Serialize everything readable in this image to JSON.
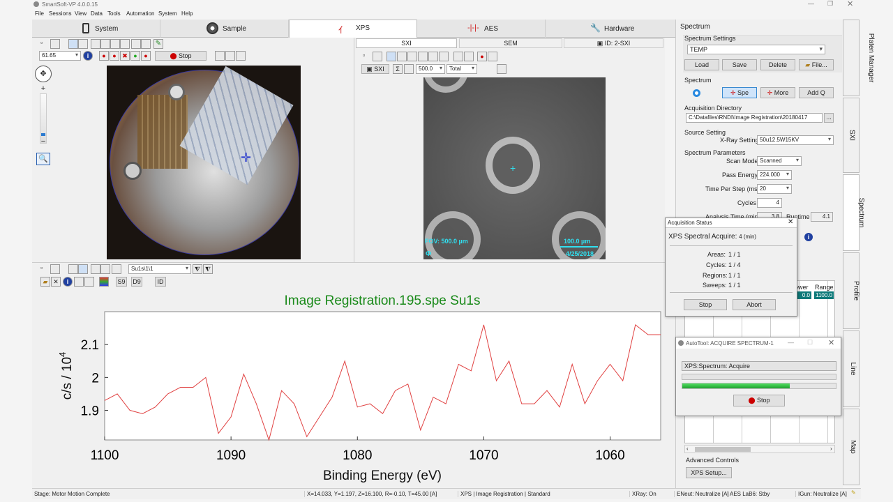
{
  "app": {
    "title": "SmartSoft-VP 4.0.0.15"
  },
  "menu": [
    "File",
    "Sessions",
    "View",
    "Data",
    "Tools",
    "Automation",
    "System",
    "Help"
  ],
  "tabs": {
    "system": "System",
    "sample": "Sample",
    "xps": "XPS",
    "aes": "AES",
    "hardware": "Hardware"
  },
  "camera": {
    "zoom_value": "61.65",
    "stop": "Stop"
  },
  "sxi": {
    "tab_sxi": "SXI",
    "tab_sem": "SEM",
    "tab_id": "ID: 2-SXI",
    "sxi_btn": "SXI",
    "size_value": "500.0",
    "mode_value": "Total",
    "fov": "FOV: 500.0 µm",
    "scale": "100.0 µm",
    "date": "4/25/2018",
    "icon_char": "Φ"
  },
  "plot_toolbar": {
    "region_value": "Su1s\\1\\1",
    "s9": "S9",
    "d9": "D9",
    "id": "ID"
  },
  "chart_data": {
    "type": "line",
    "title": "Image Registration.195.spe Su1s",
    "xlabel": "Binding Energy (eV)",
    "ylabel": "c/s / 10",
    "ylabel_exp": "4",
    "x_ticks": [
      1100,
      1090,
      1080,
      1070,
      1060
    ],
    "y_ticks": [
      1.9,
      2,
      2.1
    ],
    "x_range": [
      1100,
      1056
    ],
    "y_range": [
      1.81,
      2.2
    ],
    "x_reversed": true,
    "grid": false,
    "series": [
      {
        "color": "#e04040",
        "x": [
          1100,
          1099,
          1098,
          1097,
          1096,
          1095,
          1094,
          1093,
          1092,
          1091,
          1090,
          1089,
          1088,
          1087,
          1086,
          1085,
          1084,
          1083,
          1082,
          1081,
          1080,
          1079,
          1078,
          1077,
          1076,
          1075,
          1074,
          1073,
          1072,
          1071,
          1070,
          1069,
          1068,
          1067,
          1066,
          1065,
          1064,
          1063,
          1062,
          1061,
          1060,
          1059,
          1058,
          1057,
          1056
        ],
        "y": [
          1.93,
          1.95,
          1.9,
          1.89,
          1.91,
          1.95,
          1.97,
          1.97,
          2.0,
          1.83,
          1.88,
          2.01,
          1.92,
          1.81,
          1.96,
          1.92,
          1.82,
          1.88,
          1.94,
          2.05,
          1.91,
          1.92,
          1.89,
          1.96,
          1.98,
          1.84,
          1.94,
          1.92,
          2.04,
          2.02,
          2.16,
          1.99,
          2.05,
          1.92,
          1.92,
          1.96,
          1.91,
          2.04,
          1.92,
          1.99,
          2.04,
          1.99,
          2.16,
          2.13,
          2.13
        ]
      }
    ]
  },
  "side": {
    "header": "Spectrum",
    "settings_label": "Spectrum Settings",
    "settings_value": "TEMP",
    "load": "Load",
    "save": "Save",
    "delete": "Delete",
    "file": "File...",
    "spectrum_label": "Spectrum",
    "spe": "Spe",
    "more": "More",
    "add_q": "Add Q",
    "dir_label": "Acquisition Directory",
    "dir_value": "C:\\Datafiles\\RNDI\\Image Registration\\20180417",
    "dir_btn": "...",
    "source_label": "Source Setting",
    "xray_label": "X-Ray Setting",
    "xray_value": "50u12.5W15KV",
    "params_label": "Spectrum Parameters",
    "scan_label": "Scan Mode",
    "scan_value": "Scanned",
    "pass_label": "Pass Energy",
    "pass_value": "224.000",
    "tps_label": "Time Per Step (ms)",
    "tps_value": "20",
    "cycles_label": "Cycles",
    "cycles_value": "4",
    "analysis_label": "Analysis Time (min)",
    "analysis_value": "3.8",
    "runtime_label": "Runtime",
    "runtime_value": "4.1",
    "col_power": "ower",
    "col_range": "Range",
    "cell_power": "0.0",
    "cell_range": "1100.0",
    "advanced_label": "Advanced Controls",
    "xps_setup": "XPS Setup..."
  },
  "vtabs": [
    "Platen Manager",
    "SXI",
    "Spectrum",
    "Profile",
    "Line",
    "Map"
  ],
  "acq": {
    "title": "Acquisition Status",
    "heading": "XPS Spectral Acquire:",
    "minutes": "4 (min)",
    "areas_label": "Areas:",
    "areas_value": "1 / 1",
    "cycles_label": "Cycles:",
    "cycles_value": "1 / 4",
    "regions_label": "Regions:",
    "regions_value": "1 / 1",
    "sweeps_label": "Sweeps:",
    "sweeps_value": "1 / 1",
    "stop": "Stop",
    "abort": "Abort"
  },
  "autotool": {
    "title": "AutoTool: ACQUIRE SPECTRUM-1",
    "status": "XPS:Spectrum: Acquire",
    "progress": 0.7,
    "stop": "Stop"
  },
  "statusbar": {
    "stage": "Stage: Motor Motion Complete",
    "coords": "X=14.033, Y=1.197, Z=16.100, R=-0.10, T=45.00 [A]",
    "mode": "XPS | Image Registration | Standard",
    "xray": "XRay: On",
    "eneut": "ENeut: Neutralize [A]",
    "aes": "AES LaB6: Stby",
    "igun": "IGun: Neutralize [A]"
  },
  "colors": {
    "title_green": "#1a8a1a",
    "accent_teal": "#0e7a7a",
    "progress_green": "#30c040",
    "trace_red": "#e04040",
    "cyan": "#30e0f0"
  }
}
